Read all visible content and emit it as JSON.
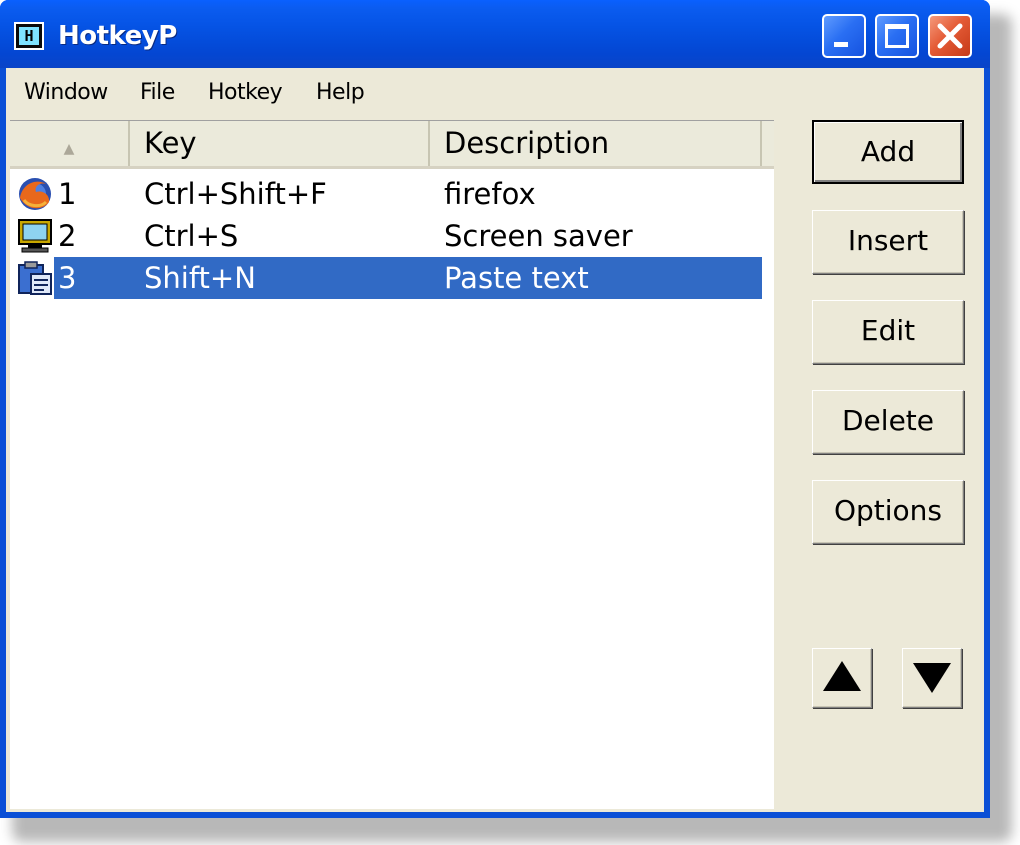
{
  "window": {
    "title": "HotkeyP",
    "app_icon_letter": "H"
  },
  "menu": {
    "items": [
      {
        "label": "Window"
      },
      {
        "label": "File"
      },
      {
        "label": "Hotkey"
      },
      {
        "label": "Help"
      }
    ]
  },
  "list": {
    "columns": [
      {
        "label": ""
      },
      {
        "label": "Key"
      },
      {
        "label": "Description"
      }
    ],
    "sort_indicator": "ascending",
    "selected_index": 2,
    "rows": [
      {
        "num": "1",
        "key": "Ctrl+Shift+F",
        "desc": "firefox",
        "icon": "firefox-icon"
      },
      {
        "num": "2",
        "key": "Ctrl+S",
        "desc": "Screen saver",
        "icon": "monitor-icon"
      },
      {
        "num": "3",
        "key": "Shift+N",
        "desc": "Paste text",
        "icon": "clipboard-icon"
      }
    ]
  },
  "buttons": {
    "add": "Add",
    "insert": "Insert",
    "edit": "Edit",
    "delete": "Delete",
    "options": "Options",
    "move_up_icon": "triangle-up-icon",
    "move_down_icon": "triangle-down-icon"
  },
  "colors": {
    "titlebar": "#0553e4",
    "selection": "#316ac5",
    "face": "#ece9d8",
    "close_button": "#e45b36"
  }
}
